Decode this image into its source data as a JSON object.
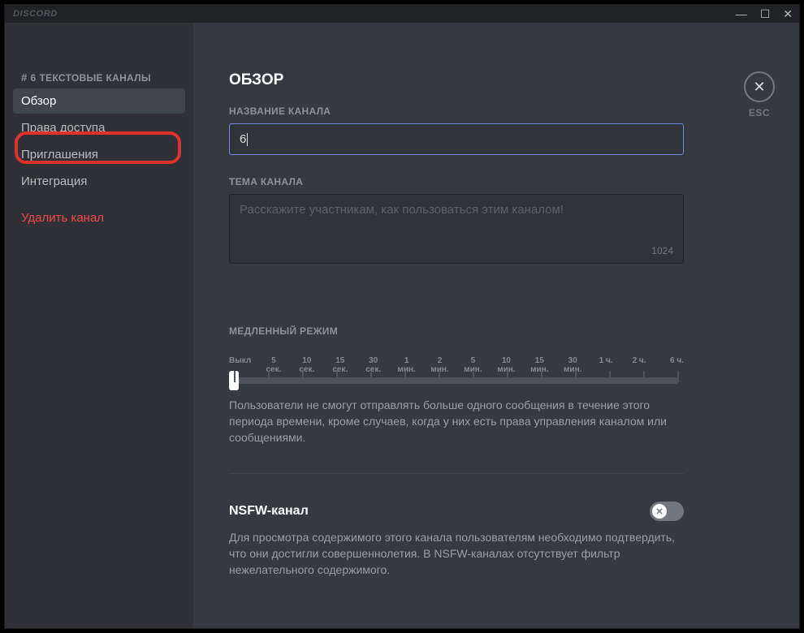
{
  "brand": "DISCORD",
  "window": {
    "min": "—",
    "max": "☐",
    "close": "✕"
  },
  "sidebar": {
    "cat_hash": "#",
    "cat_num": "6",
    "cat_label": "ТЕКСТОВЫЕ КАНАЛЫ",
    "items": [
      {
        "label": "Обзор"
      },
      {
        "label": "Права доступа"
      },
      {
        "label": "Приглашения"
      },
      {
        "label": "Интеграция"
      }
    ],
    "delete_label": "Удалить канал"
  },
  "page": {
    "title": "ОБЗОР",
    "name_label": "НАЗВАНИЕ КАНАЛА",
    "name_value": "6",
    "topic_label": "ТЕМА КАНАЛА",
    "topic_placeholder": "Расскажите участникам, как пользоваться этим каналом!",
    "topic_counter": "1024",
    "slowmode_label": "МЕДЛЕННЫЙ РЕЖИМ",
    "slowmode_help": "Пользователи не смогут отправлять больше одного сообщения в течение этого периода времени, кроме случаев, когда у них есть права управления каналом или сообщениями.",
    "ticks": [
      "Выкл",
      "5\nсек.",
      "10\nсек.",
      "15\nсек.",
      "30\nсек.",
      "1\nмин.",
      "2\nмин.",
      "5\nмин.",
      "10\nмин.",
      "15\nмин.",
      "30\nмин.",
      "1 ч.",
      "2 ч.",
      "6 ч."
    ],
    "nsfw_title": "NSFW-канал",
    "nsfw_help": "Для просмотра содержимого этого канала пользователям необходимо подтвердить, что они достигли совершеннолетия. В NSFW-каналах отсутствует фильтр нежелательного содержимого."
  },
  "close": {
    "x": "✕",
    "label": "ESC"
  }
}
